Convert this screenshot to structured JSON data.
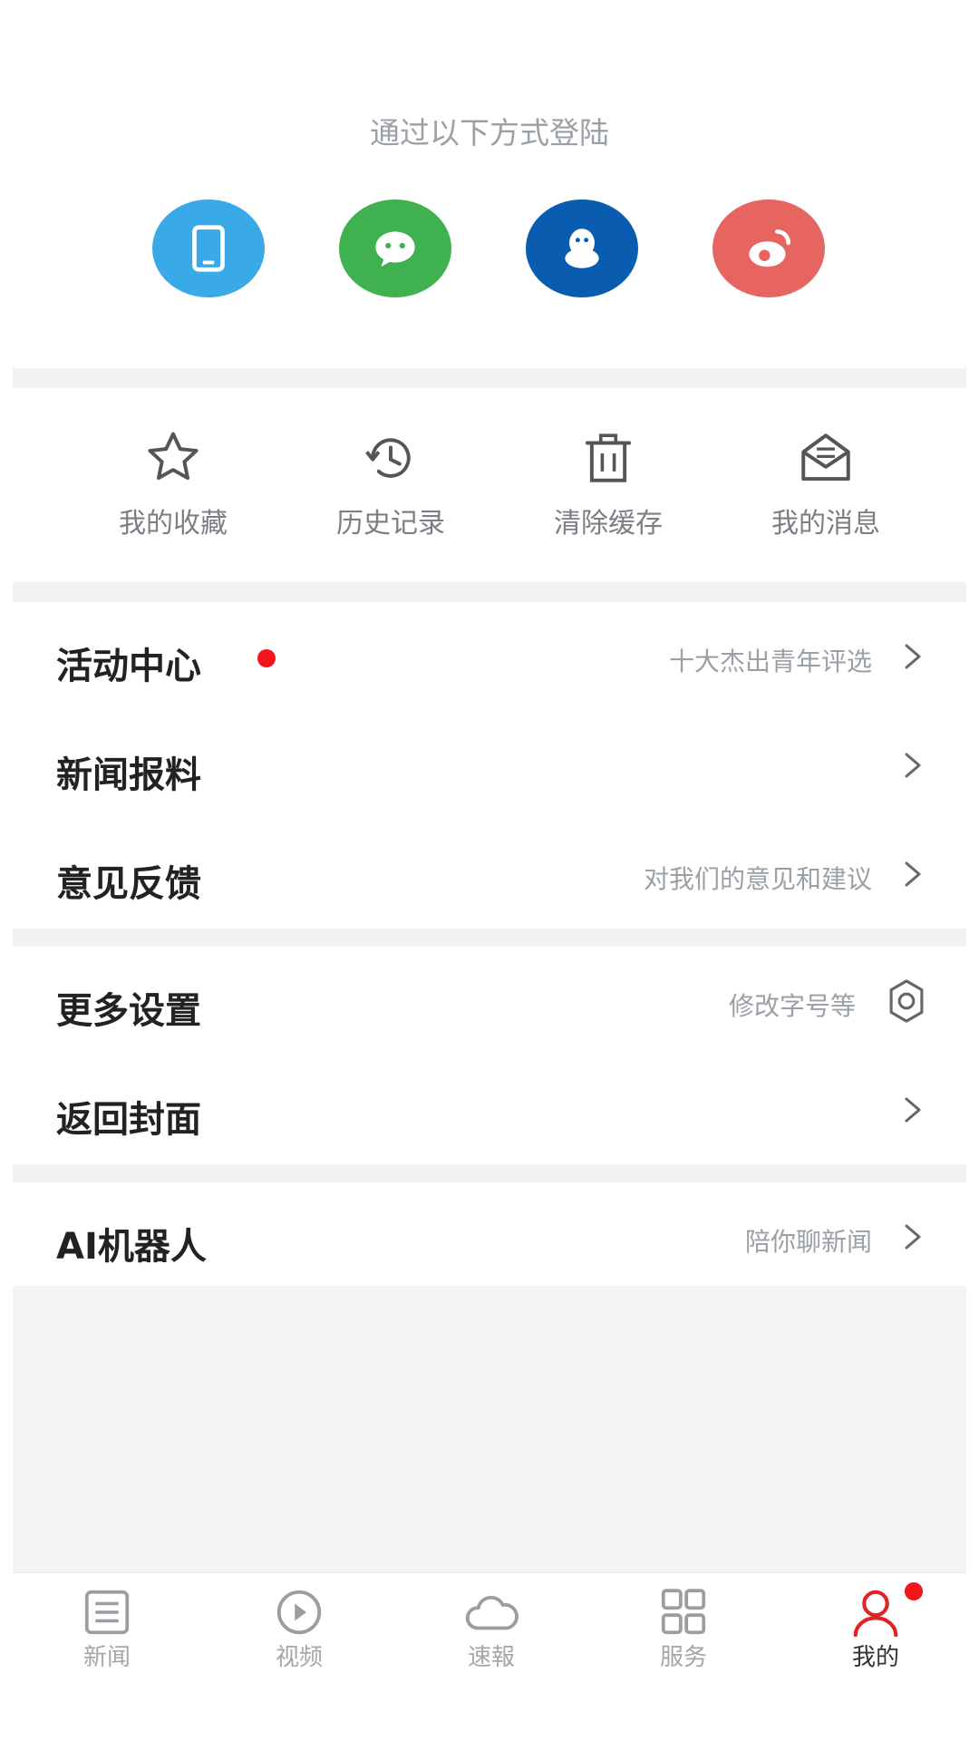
{
  "login": {
    "title": "通过以下方式登陆",
    "methods": [
      {
        "icon": "phone-icon",
        "color": "#3aa9e8"
      },
      {
        "icon": "wechat-icon",
        "color": "#3fb24f"
      },
      {
        "icon": "qq-icon",
        "color": "#0a5cb0"
      },
      {
        "icon": "weibo-icon",
        "color": "#e76561"
      }
    ]
  },
  "quick_actions": [
    {
      "label": "我的收藏",
      "icon": "star-icon"
    },
    {
      "label": "历史记录",
      "icon": "history-icon"
    },
    {
      "label": "清除缓存",
      "icon": "trash-icon"
    },
    {
      "label": "我的消息",
      "icon": "message-icon"
    }
  ],
  "menu": {
    "group1": [
      {
        "label": "活动中心",
        "sub": "十大杰出青年评选",
        "dot": true
      },
      {
        "label": "新闻报料",
        "sub": ""
      },
      {
        "label": "意见反馈",
        "sub": "对我们的意见和建议"
      }
    ],
    "group2": [
      {
        "label": "更多设置",
        "sub": "修改字号等",
        "icon": "gear-icon"
      },
      {
        "label": "返回封面",
        "sub": ""
      }
    ],
    "group3": [
      {
        "label": "AI机器人",
        "sub": "陪你聊新闻"
      }
    ]
  },
  "tabbar": [
    {
      "label": "新闻",
      "icon": "news-icon"
    },
    {
      "label": "视频",
      "icon": "video-icon"
    },
    {
      "label": "速報",
      "icon": "cloud-icon"
    },
    {
      "label": "服务",
      "icon": "grid-icon"
    },
    {
      "label": "我的",
      "icon": "user-icon",
      "active": true
    }
  ],
  "colors": {
    "accent": "#e02424",
    "page_bg": "#f2f3f5"
  }
}
